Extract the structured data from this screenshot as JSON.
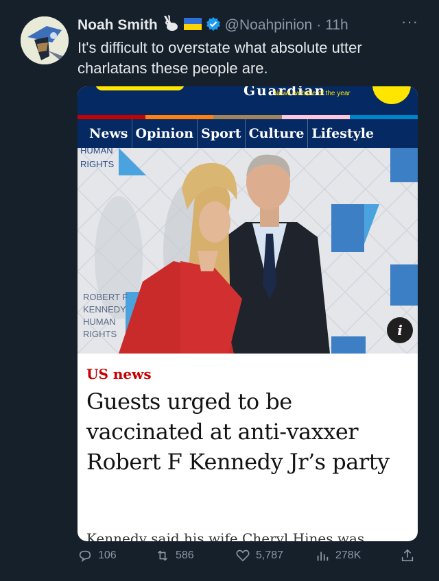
{
  "tweet": {
    "author_name": "Noah Smith",
    "author_handle": "@Noahpinion",
    "separator": "·",
    "time": "11h",
    "more": "···",
    "text": "It's difficult to overstate what absolute utter charlatans these people are."
  },
  "card": {
    "masthead_partial": "Guardian",
    "award_text": "News website of the year",
    "nav": [
      "News",
      "Opinion",
      "Sport",
      "Culture",
      "Lifestyle"
    ],
    "pillar_colors": [
      "#c70000",
      "#ff7f0f",
      "#a1845c",
      "#ffc7dd",
      "#0084c6"
    ],
    "photo_backdrop_texts": [
      "HUMAN\nRIGHTS",
      "ROBERT F\nKENNEDY\nHUMAN\nRIGHTS"
    ],
    "info_label": "i",
    "kicker": "US news",
    "headline": "Guests urged to be vaccinated at anti-vaxxer Robert F Kennedy Jr’s party",
    "standfirst": "Kennedy said his wife Cheryl Hines was"
  },
  "actions": {
    "replies": "106",
    "retweets": "586",
    "likes": "5,787",
    "views": "278K"
  },
  "colors": {
    "background": "#15202b",
    "secondary_text": "#8b98a5",
    "verified": "#1d9bf0",
    "guardian_blue": "#052962",
    "guardian_red": "#c70000",
    "guardian_yellow": "#ffe500"
  }
}
